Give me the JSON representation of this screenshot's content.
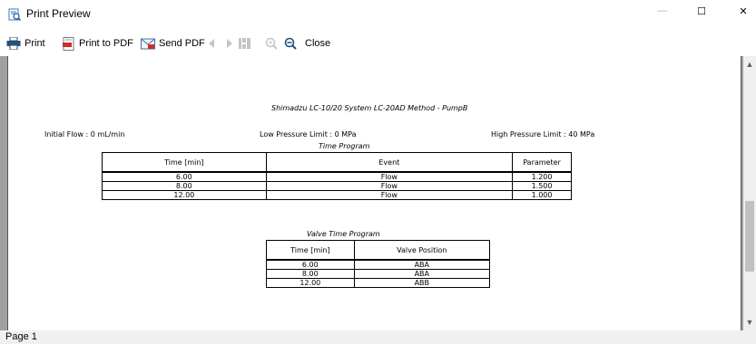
{
  "window": {
    "title": "Print Preview",
    "minimize_label": "—",
    "maximize_label": "☐",
    "close_label": "✕"
  },
  "toolbar": {
    "print_label": "Print",
    "print_pdf_label": "Print to PDF",
    "send_pdf_label": "Send PDF",
    "close_label": "Close",
    "icons": [
      "printer-icon",
      "pdf-icon",
      "send-pdf-icon",
      "prev-page-icon",
      "next-page-icon",
      "page-layout-icon",
      "zoom-in-icon",
      "zoom-out-icon"
    ]
  },
  "document": {
    "title": "Shimadzu LC-10/20 System LC-20AD Method - PumpB",
    "initial_flow": "Initial Flow   : 0 mL/min",
    "low_pressure": "Low Pressure Limit   : 0 MPa",
    "high_pressure": "High Pressure Limit   : 40 MPa",
    "time_program": {
      "caption": "Time Program",
      "headers": [
        "Time [min]",
        "Event",
        "Parameter"
      ],
      "rows": [
        [
          "6.00",
          "Flow",
          "1.200"
        ],
        [
          "8.00",
          "Flow",
          "1.500"
        ],
        [
          "12.00",
          "Flow",
          "1.000"
        ]
      ]
    },
    "valve_program": {
      "caption": "Valve Time Program",
      "headers": [
        "Time [min]",
        "Valve Position"
      ],
      "rows": [
        [
          "6.00",
          "ABA"
        ],
        [
          "8.00",
          "ABA"
        ],
        [
          "12.00",
          "ABB"
        ]
      ]
    }
  },
  "status": {
    "page": "Page 1"
  },
  "colors": {
    "viewport_bg": "#a0a0a0",
    "statusbar_bg": "#f0f0f0",
    "scroll_thumb": "#c1c1c1"
  }
}
